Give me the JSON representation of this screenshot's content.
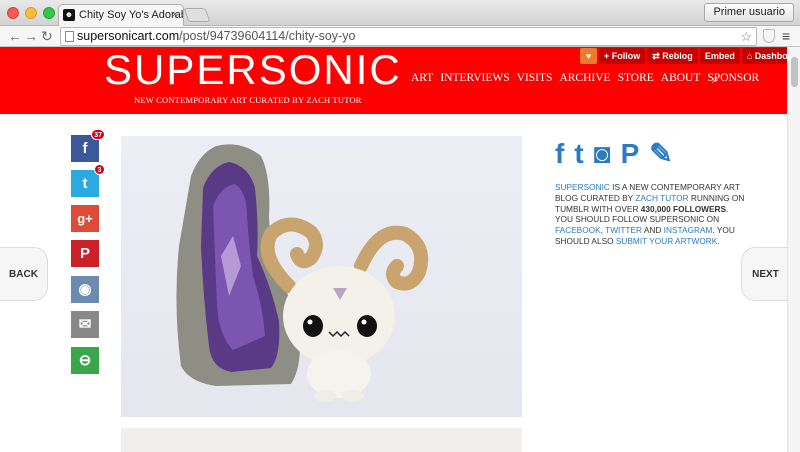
{
  "browser": {
    "tab_title": "Chity Soy Yo's Adorable C",
    "tab_close": "×",
    "profile_button": "Primer usuario",
    "url_host": "supersonicart.com",
    "url_path": "/post/94739604114/chity-soy-yo",
    "back_glyph": "←",
    "forward_glyph": "→",
    "reload_glyph": "↻",
    "star_glyph": "☆",
    "menu_glyph": "≡"
  },
  "tumblr_bar": {
    "heart": "♥",
    "follow": "+ Follow",
    "reblog": "⇄ Reblog",
    "embed": "Embed",
    "dashboard": "⌂ Dashboard"
  },
  "site": {
    "logo": "SUPERSONIC",
    "tagline": "NEW CONTEMPORARY ART CURATED BY ZACH TUTOR",
    "nav": [
      "ART",
      "INTERVIEWS",
      "VISITS",
      "ARCHIVE",
      "STORE",
      "ABOUT",
      "SPONSOR"
    ],
    "search_glyph": "⌕"
  },
  "share": {
    "facebook": {
      "glyph": "f",
      "count": "37",
      "color": "#3b5998"
    },
    "twitter": {
      "glyph": "t",
      "count": "3",
      "color": "#2ba9e1"
    },
    "google_plus": {
      "glyph": "g+",
      "color": "#dd4b39"
    },
    "pinterest": {
      "glyph": "P",
      "color": "#cb2027"
    },
    "reddit": {
      "glyph": "◉",
      "color": "#6b8bb0"
    },
    "email": {
      "glyph": "✉",
      "color": "#888888"
    },
    "sharethis": {
      "glyph": "⊖",
      "color": "#3aa84a"
    }
  },
  "nav_buttons": {
    "back": "BACK",
    "next": "NEXT"
  },
  "sidebar": {
    "social_glyphs": [
      "f",
      "t",
      "◙",
      "P",
      "✎"
    ],
    "about": {
      "brand": "SUPERSONIC",
      "t1": " IS A NEW CONTEMPORARY ART BLOG CURATED BY ",
      "curator": "ZACH TUTOR",
      "t2": " RUNNING ON TUMBLR WITH OVER ",
      "followers": "430,000 FOLLOWERS",
      "t3": ". YOU SHOULD FOLLOW SUPERSONIC ON ",
      "facebook": "FACEBOOK",
      "t4": ", ",
      "twitter": "TWITTER",
      "t5": " AND ",
      "instagram": "INSTAGRAM",
      "t6": ". YOU SHOULD ALSO ",
      "submit": "SUBMIT YOUR ARTWORK",
      "t7": "."
    }
  },
  "colors": {
    "header_red": "#ff0000",
    "link_blue": "#2b7bc2"
  }
}
